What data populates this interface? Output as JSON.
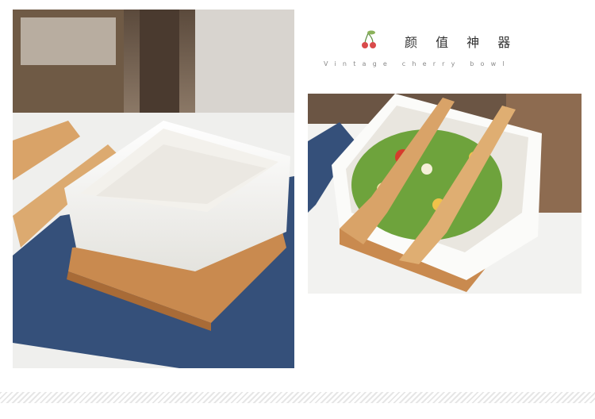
{
  "heading": {
    "title": "颜 值 神 器",
    "subtitle": "Vintage cherry bowl",
    "cherry_icon": "cherry-icon",
    "accent_color": "#d94b4b"
  },
  "photos": {
    "left": {
      "subject": "empty white square ceramic bowl on bamboo tray with wooden utensils"
    },
    "right": {
      "subject": "white square bowl with salad and wooden fork and spoon"
    }
  },
  "colors": {
    "wood": "#d9a368",
    "ceramic": "#f6f5f0",
    "napkin": "#35507a",
    "background": "#ffffff"
  }
}
